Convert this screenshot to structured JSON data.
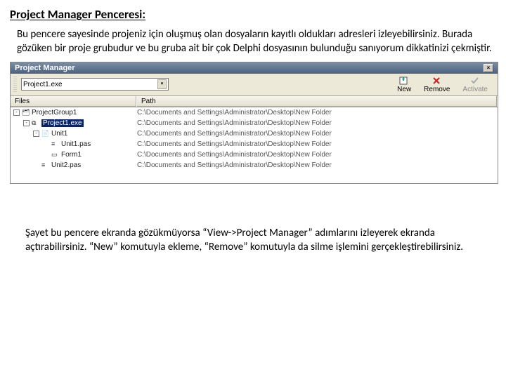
{
  "doc": {
    "heading": "Project Manager Penceresi:",
    "intro": "Bu pencere sayesinde projeniz için oluşmuş olan dosyaların kayıtlı oldukları adresleri izleyebilirsiniz. Burada gözüken bir proje grubudur ve bu gruba ait bir çok Delphi dosyasının bulunduğu sanıyorum dikkatinizi çekmiştir.",
    "outro": "Şayet bu pencere ekranda gözükmüyorsa “View->Project Manager” adımlarını izleyerek ekranda açtırabilirsiniz. “New” komutuyla ekleme, “Remove” komutuyla da silme işlemini gerçekleştirebilirsiniz."
  },
  "window": {
    "title": "Project Manager",
    "combo_value": "Project1.exe",
    "toolbar": {
      "new_label": "New",
      "remove_label": "Remove",
      "activate_label": "Activate"
    },
    "columns": {
      "files": "Files",
      "path": "Path"
    },
    "rows": [
      {
        "indent": 0,
        "box": "-",
        "icon": "project-group-icon",
        "label": "ProjectGroup1",
        "path": "C:\\Documents and Settings\\Administrator\\Desktop\\New Folder",
        "sel": false
      },
      {
        "indent": 1,
        "box": "-",
        "icon": "project-icon",
        "label": "Project1.exe",
        "path": "C:\\Documents and Settings\\Administrator\\Desktop\\New Folder",
        "sel": true
      },
      {
        "indent": 2,
        "box": "-",
        "icon": "unit-icon",
        "label": "Unit1",
        "path": "C:\\Documents and Settings\\Administrator\\Desktop\\New Folder",
        "sel": false
      },
      {
        "indent": 3,
        "box": "",
        "icon": "pas-icon",
        "label": "Unit1.pas",
        "path": "C:\\Documents and Settings\\Administrator\\Desktop\\New Folder",
        "sel": false
      },
      {
        "indent": 3,
        "box": "",
        "icon": "form-icon",
        "label": "Form1",
        "path": "C:\\Documents and Settings\\Administrator\\Desktop\\New Folder",
        "sel": false
      },
      {
        "indent": 2,
        "box": "",
        "icon": "pas-icon",
        "label": "Unit2.pas",
        "path": "C:\\Documents and Settings\\Administrator\\Desktop\\New Folder",
        "sel": false
      }
    ]
  },
  "icons": {
    "project-group-icon": "🗂",
    "project-icon": "⧉",
    "unit-icon": "📄",
    "pas-icon": "≡",
    "form-icon": "▭",
    "new-icon": "✚",
    "remove-icon": "✖",
    "activate-icon": "✔"
  }
}
